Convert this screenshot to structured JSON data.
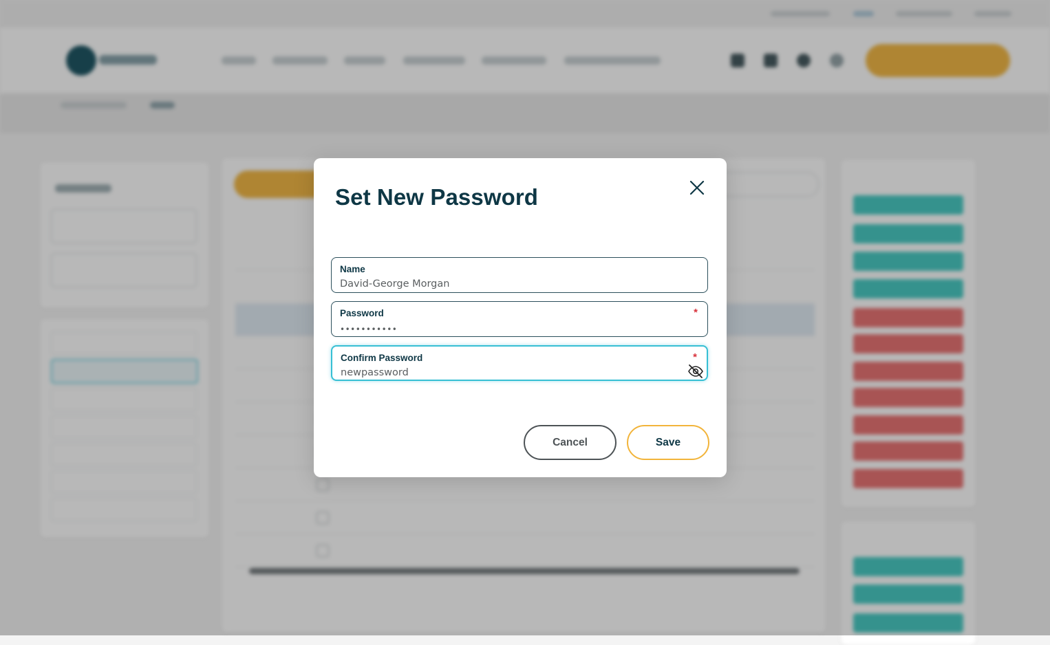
{
  "modal": {
    "title": "Set New Password",
    "fields": {
      "name": {
        "label": "Name",
        "value": "David-George Morgan"
      },
      "password": {
        "label": "Password",
        "value": "•••••••••••",
        "required_mark": "*"
      },
      "confirm": {
        "label": "Confirm Password",
        "value": "newpassword",
        "required_mark": "*"
      }
    },
    "buttons": {
      "cancel": "Cancel",
      "save": "Save"
    }
  },
  "colors": {
    "primary_text": "#0e3745",
    "focus_border": "#36bfd4",
    "save_border": "#f2b43a",
    "required": "#d8323c",
    "brand_yellow": "#f2b43a",
    "tag_teal": "#3cc7bf",
    "tag_red": "#e86b6b"
  },
  "icons": {
    "close": "close-icon",
    "toggle_visibility": "eye-slash-icon"
  }
}
